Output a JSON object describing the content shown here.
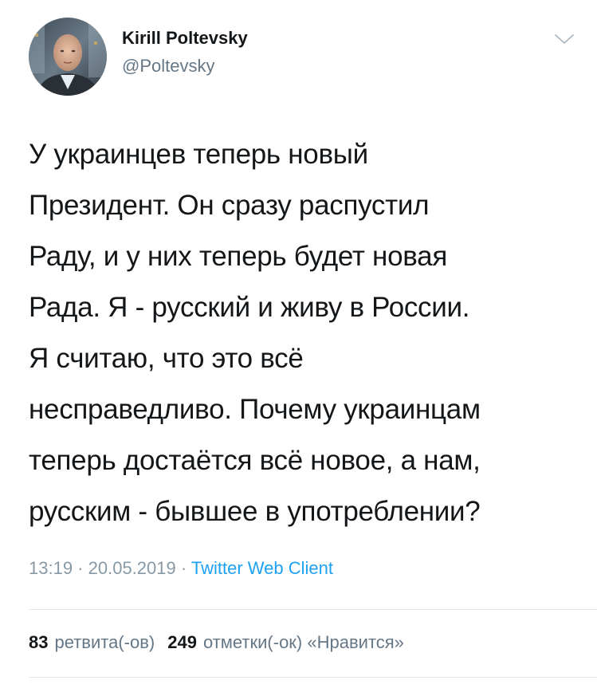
{
  "author": {
    "display_name": "Kirill Poltevsky",
    "handle": "@Poltevsky",
    "avatar_icon": "avatar-photo"
  },
  "header": {
    "menu_icon": "chevron-down-icon"
  },
  "tweet": {
    "text": "У украинцев теперь новый\nПрезидент. Он сразу распустил\nРаду, и у них теперь будет новая\nРада. Я - русский и живу в России.\nЯ считаю, что это всё\nнесправедливо. Почему украинцам\nтеперь достаётся всё новое, а нам,\nрусским - бывшее в употреблении?"
  },
  "meta": {
    "time": "13:19",
    "separator": " · ",
    "date": "20.05.2019",
    "source": "Twitter Web Client"
  },
  "stats": {
    "retweets_count": "83",
    "retweets_label": "ретвита(-ов)",
    "likes_count": "249",
    "likes_label": "отметки(-ок) «Нравится»"
  },
  "colors": {
    "text": "#14171a",
    "secondary": "#657786",
    "link": "#1da1f2",
    "divider": "#e1e8ed"
  }
}
